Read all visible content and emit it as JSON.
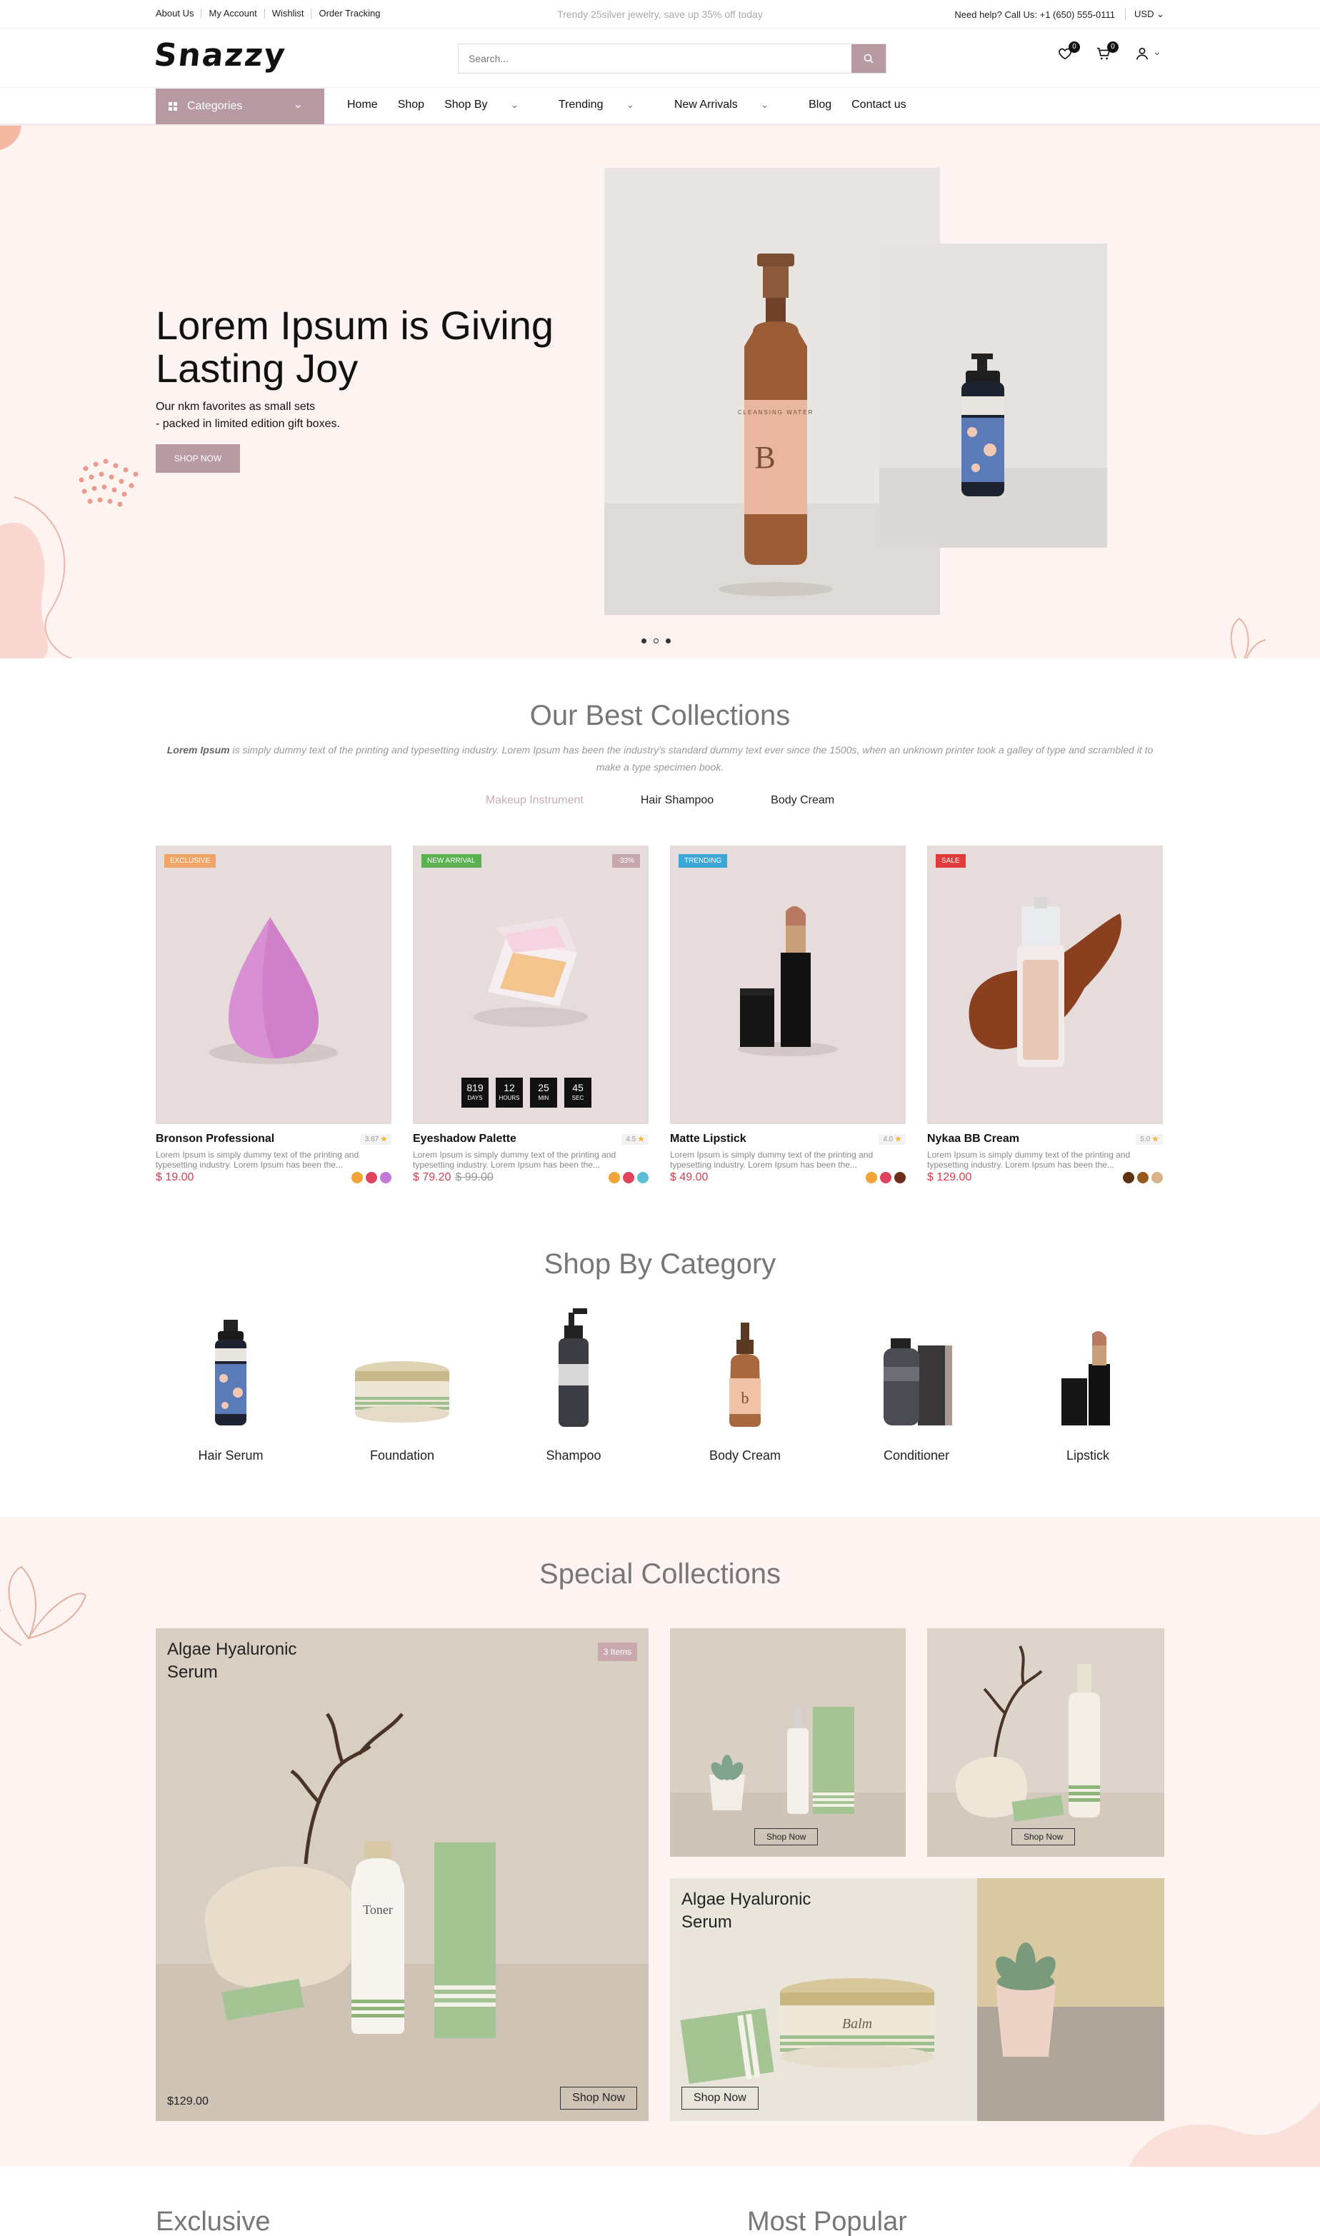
{
  "topbar": {
    "links": [
      "About Us",
      "My Account",
      "Wishlist",
      "Order Tracking"
    ],
    "promo": "Trendy 25silver jewelry, save up 35% off today",
    "help": "Need help? Call Us: +1 (650) 555-0111",
    "currency": "USD"
  },
  "header": {
    "logo": "Snazzy",
    "search_placeholder": "Search...",
    "wishlist_count": "0",
    "cart_count": "0"
  },
  "nav": {
    "categories_label": "Categories",
    "items": [
      "Home",
      "Shop",
      "Shop By",
      "Trending",
      "New Arrivals",
      "Blog",
      "Contact us"
    ]
  },
  "hero": {
    "title": "Lorem Ipsum is Giving Lasting Joy",
    "line1": "Our nkm favorites as small sets",
    "line2": "- packed in limited edition gift boxes.",
    "cta": "SHOP NOW",
    "bottle_label": "CLEANSING WATER"
  },
  "best": {
    "title": "Our Best Collections",
    "intro_bold": "Lorem Ipsum",
    "intro": " is simply dummy text of the printing and typesetting industry. Lorem Ipsum has been the industry's standard dummy text ever since the 1500s, when an unknown printer took a galley of type and scrambled it to make a type specimen book.",
    "tabs": [
      "Makeup Instrument",
      "Hair Shampoo",
      "Body Cream"
    ],
    "products": [
      {
        "tag": "EXCLUSIVE",
        "tag_color": "#f0a567",
        "name": "Bronson Professional",
        "rating": "3.67",
        "desc": "Lorem Ipsum is simply dummy text of the printing and typesetting industry. Lorem Ipsum has been the...",
        "price": "$ 19.00",
        "old_price": "",
        "swatches": [
          "#f2a536",
          "#e0425a",
          "#c27ad8"
        ]
      },
      {
        "tag": "NEW ARRIVAL",
        "tag_color": "#59b24f",
        "discount": "-33%",
        "name": "Eyeshadow Palette",
        "rating": "4.5",
        "desc": "Lorem Ipsum is simply dummy text of the printing and typesetting industry. Lorem Ipsum has been the...",
        "price": "$ 79.20",
        "old_price": "$ 99.00",
        "swatches": [
          "#f2a536",
          "#e0425a",
          "#5bbfd6"
        ],
        "timer": {
          "days": "819",
          "hours": "12",
          "min": "25",
          "sec": "45",
          "days_lbl": "DAYS",
          "hours_lbl": "HOURS",
          "min_lbl": "MIN",
          "sec_lbl": "SEC"
        }
      },
      {
        "tag": "TRENDING",
        "tag_color": "#3aa7d6",
        "name": "Matte Lipstick",
        "rating": "4.0",
        "desc": "Lorem Ipsum is simply dummy text of the printing and typesetting industry. Lorem Ipsum has been the...",
        "price": "$ 49.00",
        "old_price": "",
        "swatches": [
          "#f2a536",
          "#e0425a",
          "#6b2f1c"
        ]
      },
      {
        "tag": "SALE",
        "tag_color": "#e23b3b",
        "name": "Nykaa BB Cream",
        "rating": "5.0",
        "desc": "Lorem Ipsum is simply dummy text of the printing and typesetting industry. Lorem Ipsum has been the...",
        "price": "$ 129.00",
        "old_price": "",
        "swatches": [
          "#5b3312",
          "#9a5a1c",
          "#d9b38a"
        ]
      }
    ]
  },
  "categories": {
    "title": "Shop By Category",
    "items": [
      "Hair Serum",
      "Foundation",
      "Shampoo",
      "Body Cream",
      "Conditioner",
      "Lipstick"
    ]
  },
  "special": {
    "title": "Special Collections",
    "big_title": "Algae Hyaluronic Serum",
    "big_count": "3 Items",
    "big_price": "$129.00",
    "big_btn": "Shop Now",
    "small_btn": "Shop Now",
    "wide_title": "Algae Hyaluronic Serum",
    "wide_btn": "Shop Now",
    "toner_label": "Toner",
    "balm_label": "Balm"
  },
  "bottom": {
    "left": "Exclusive",
    "right": "Most Popular"
  },
  "colors": {
    "accent": "#b89aa3",
    "hero_bg": "#fdf3f1",
    "price": "#d33f4f"
  }
}
